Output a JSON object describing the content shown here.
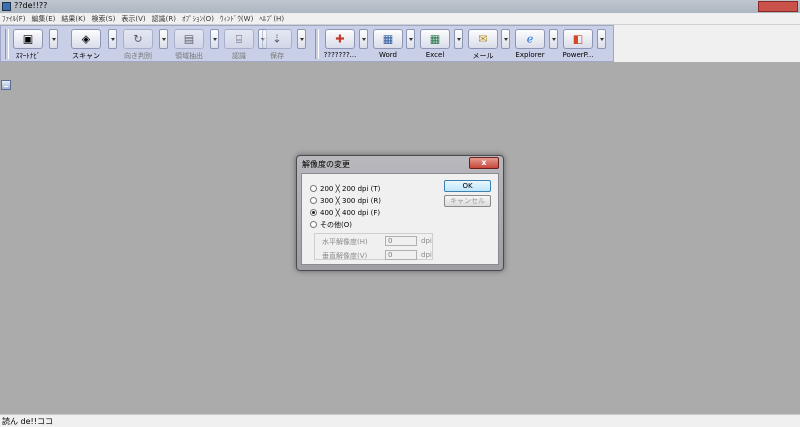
{
  "window": {
    "title": "??de!!??"
  },
  "menu": [
    "ﾌｧｲﾙ(F)",
    "編集(E)",
    "結果(K)",
    "検索(S)",
    "表示(V)",
    "認識(R)",
    "ｵﾌﾟｼｮﾝ(O)",
    "ｳｨﾝﾄﾞｳ(W)",
    "ﾍﾙﾌﾟ(H)"
  ],
  "toolbar": {
    "buttons": [
      {
        "label": "ｽﾏｰﾄﾅﾋﾞ",
        "icon": "smart-navi-icon",
        "enabled": true
      },
      {
        "label": "スキャン",
        "icon": "scanner-icon",
        "enabled": true
      },
      {
        "label": "向き判別",
        "icon": "orientation-icon",
        "enabled": false
      },
      {
        "label": "領域抽出",
        "icon": "region-extract-icon",
        "enabled": false
      },
      {
        "label": "認識",
        "icon": "recognize-icon",
        "enabled": false
      },
      {
        "label": "保存",
        "icon": "save-icon",
        "enabled": false
      },
      {
        "label": "???????...",
        "icon": "clipboard-icon",
        "enabled": true
      },
      {
        "label": "Word",
        "icon": "word-doc-icon",
        "enabled": true
      },
      {
        "label": "Excel",
        "icon": "excel-sheet-icon",
        "enabled": true
      },
      {
        "label": "メール",
        "icon": "mail-icon",
        "enabled": true
      },
      {
        "label": "Explorer",
        "icon": "explorer-icon",
        "enabled": true
      },
      {
        "label": "PowerP...",
        "icon": "powerpoint-icon",
        "enabled": true
      }
    ]
  },
  "dialog": {
    "title": "解像度の変更",
    "close_label": "x",
    "options": [
      {
        "label": "200 ╳ 200 dpi (T)",
        "checked": false
      },
      {
        "label": "300 ╳ 300 dpi (R)",
        "checked": false
      },
      {
        "label": "400 ╳ 400 dpi (F)",
        "checked": true
      },
      {
        "label": "その他(O)",
        "checked": false
      }
    ],
    "horizontal": {
      "label": "水平解像度(H)",
      "value": "0",
      "unit": "dpi"
    },
    "vertical": {
      "label": "垂直解像度(V)",
      "value": "0",
      "unit": "dpi"
    },
    "ok_label": "OK",
    "cancel_label": "キャンセル"
  },
  "statusbar": {
    "text": "読ん de!!ココ"
  }
}
